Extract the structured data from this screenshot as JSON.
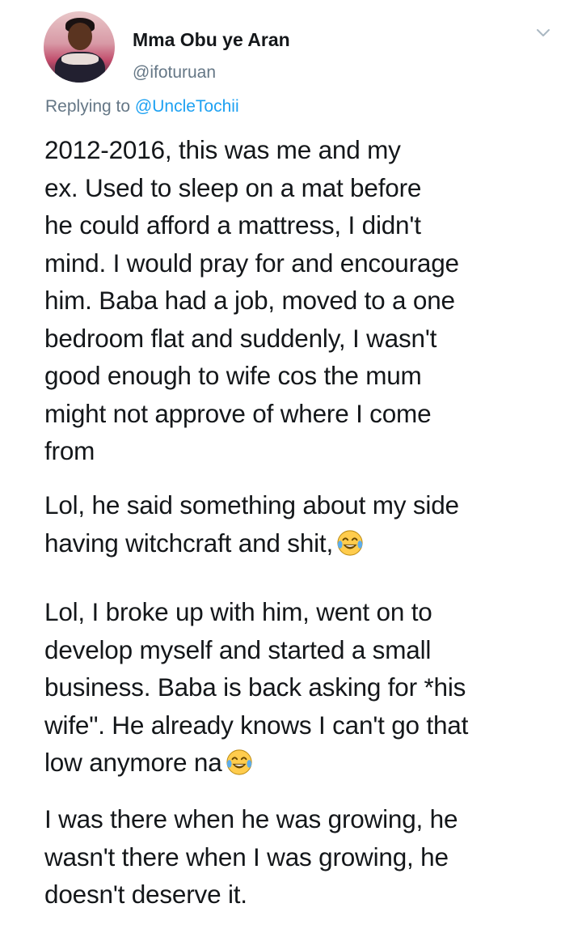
{
  "tweet": {
    "author": {
      "display_name": "Mma Obu ye Aran",
      "handle": "@ifoturuan"
    },
    "replying_to": {
      "prefix": "Replying to ",
      "mention": "@UncleTochii"
    },
    "paragraphs": {
      "p1": "2012-2016, this was me and my\nex. Used to sleep on a mat before\nhe could afford a mattress, I didn't\nmind. I would pray for and encourage\nhim. Baba had a job, moved to a one\nbedroom flat and suddenly, I wasn't\ngood enough to wife cos the mum\nmight not approve of where I come\nfrom",
      "p2": "Lol, he said something about my side\nhaving witchcraft and shit,",
      "p3": "Lol, I broke up with him, went on to\ndevelop myself and started a small\nbusiness. Baba is back asking for *his\nwife\". He already knows I can't go that\nlow anymore na",
      "p4": "I was there when he was growing, he\nwasn't there when I was growing, he\ndoesn't deserve it."
    },
    "icons": {
      "menu": "chevron-down-icon",
      "emoji": "face-with-tears-of-joy-icon"
    },
    "colors": {
      "text": "#14171a",
      "secondary": "#657786",
      "link": "#1da1f2"
    }
  }
}
